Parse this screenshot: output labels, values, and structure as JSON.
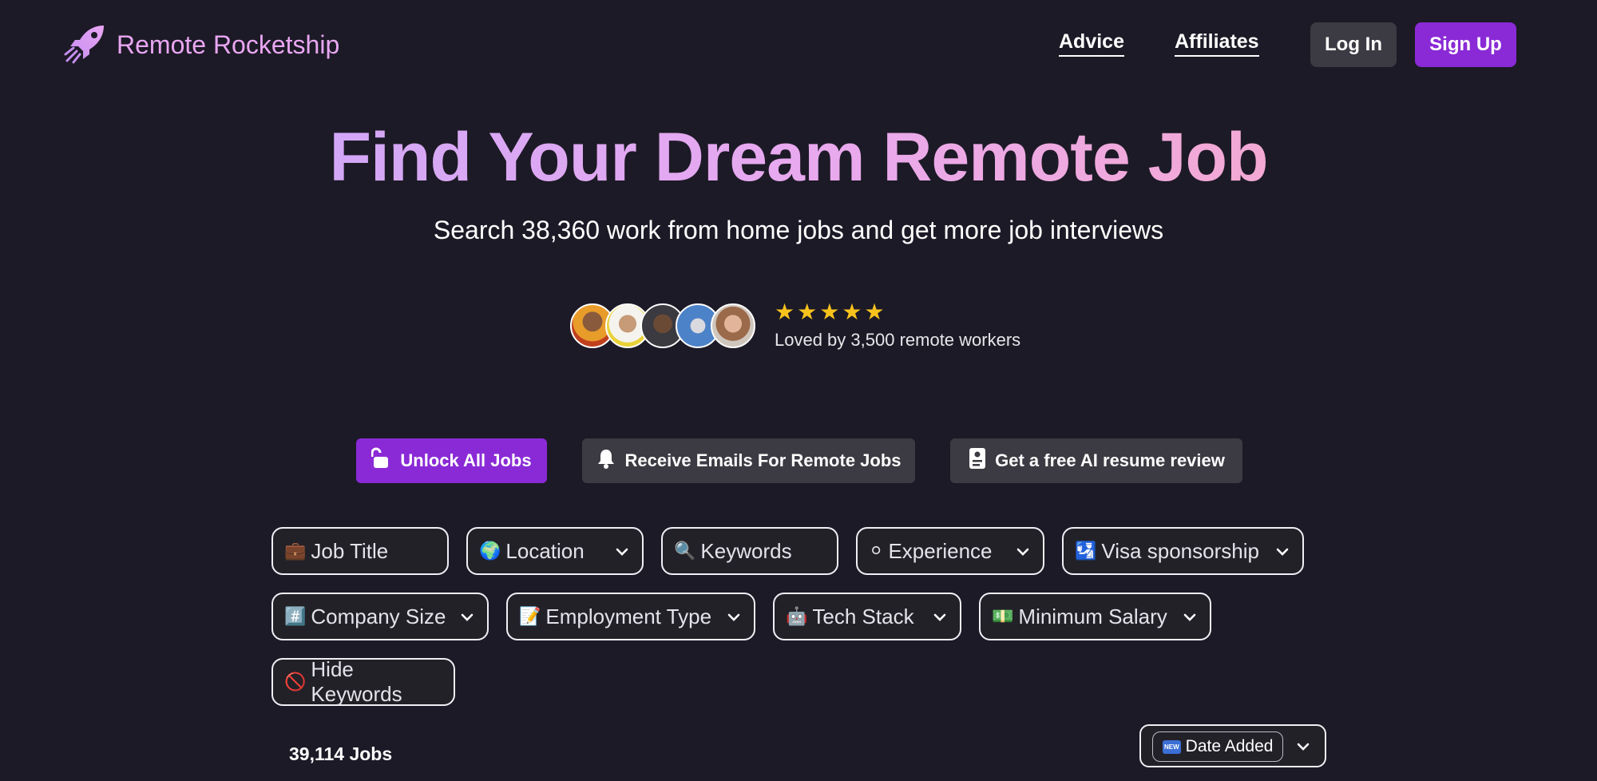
{
  "header": {
    "brand": "Remote Rocketship",
    "nav": [
      "Advice",
      "Affiliates"
    ],
    "login_label": "Log In",
    "signup_label": "Sign Up"
  },
  "hero": {
    "title": "Find Your Dream Remote Job",
    "subtitle": "Search 38,360 work from home jobs and get more job interviews",
    "rating_stars": 5,
    "loved_text": "Loved by 3,500 remote workers"
  },
  "cta": {
    "unlock": "Unlock All Jobs",
    "emails": "Receive Emails For Remote Jobs",
    "resume": "Get a free AI resume review"
  },
  "filters": {
    "job_title": {
      "icon": "💼",
      "label": "Job Title"
    },
    "location": {
      "icon": "🌍",
      "label": "Location"
    },
    "keywords": {
      "icon": "🔍",
      "label": "Keywords"
    },
    "experience": {
      "icon": "⚪",
      "label": "Experience"
    },
    "visa": {
      "icon": "🛂",
      "label": "Visa sponsorship"
    },
    "company_size": {
      "icon": "#️⃣",
      "label": "Company Size"
    },
    "employment_type": {
      "icon": "📝",
      "label": "Employment Type"
    },
    "tech_stack": {
      "icon": "🤖",
      "label": "Tech Stack"
    },
    "minimum_salary": {
      "icon": "💵",
      "label": "Minimum Salary"
    },
    "hide_keywords": {
      "icon": "🚫",
      "label": "Hide Keywords"
    }
  },
  "results": {
    "count_label": "39,114 Jobs",
    "sort_selected": "Date Added",
    "sort_badge": "NEW"
  },
  "colors": {
    "background": "#1c1a26",
    "accent": "#8a2ad6",
    "brand": "#e9a6f2",
    "star": "#f7c21c"
  }
}
